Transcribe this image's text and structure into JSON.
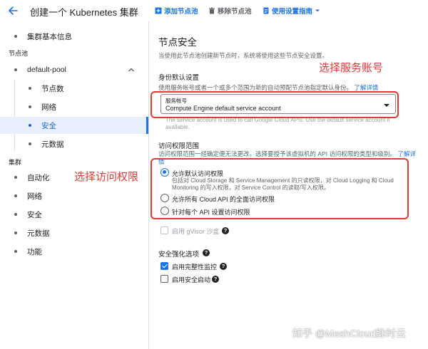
{
  "header": {
    "title": "创建一个 Kubernetes 集群",
    "add_node_pool": "添加节点池",
    "remove_node_pool": "移除节点池",
    "setup_guide": "使用设置指南"
  },
  "sidebar": {
    "cluster_basics": "集群基本信息",
    "node_pools_section": "节点池",
    "pool_name": "default-pool",
    "pool_items": [
      "节点数",
      "网络",
      "安全",
      "元数据"
    ],
    "active_item": "安全",
    "cluster_section": "集群",
    "cluster_items": [
      "自动化",
      "网络",
      "安全",
      "元数据",
      "功能"
    ]
  },
  "main": {
    "title": "节点安全",
    "intro": "当使用此节点池创建新节点时，系统将使用这些节点安全设置。",
    "identity_heading": "身份默认设置",
    "identity_desc": "使用服务帐号或者一个或多个范围为新的自动预配节点池指定默认身份。",
    "learn_more": "了解详情",
    "service_account": {
      "label": "服务帐号",
      "value": "Compute Engine default service account",
      "helper_line1": "The service account is used to call Google Cloud APIs. Use the default service account if",
      "helper_line2": "available."
    },
    "access_scope": {
      "heading": "访问权限范围",
      "desc_line1": "访问权限范围一经确定便无法更改。选择要授予该虚拟机的 API 访问权限的类型和级别。",
      "learn_more": "了解详",
      "learn_more_cont": "情",
      "options": [
        {
          "label": "允许默认访问权限",
          "desc_line1": "包括对 Cloud Storage 和 Service Management 的只读权限，对 Cloud Logging 和 Cloud",
          "desc_line2": "Monitoring 的写入权限，对 Service Control 的读取/写入权限。",
          "checked": true
        },
        {
          "label": "允许所有 Cloud API 的全面访问权限",
          "checked": false
        },
        {
          "label": "针对每个 API 设置访问权限",
          "checked": false
        }
      ]
    },
    "gvisor": {
      "label": "启用 gVisor 沙盒",
      "checked": false,
      "disabled": true
    },
    "hardening": {
      "heading": "安全强化选项",
      "integrity_monitoring": {
        "label": "启用完整性监控",
        "checked": true
      },
      "secure_boot": {
        "label": "启用安全启动",
        "checked": false
      }
    }
  },
  "annotations": {
    "service_account": "选择服务账号",
    "access_scope": "选择访问权限"
  },
  "watermark": "知乎 @MeshCloud脉时云",
  "colors": {
    "accent": "#1a73e8",
    "annotation_red": "#e53935",
    "active_bg": "#e8f0fe"
  }
}
